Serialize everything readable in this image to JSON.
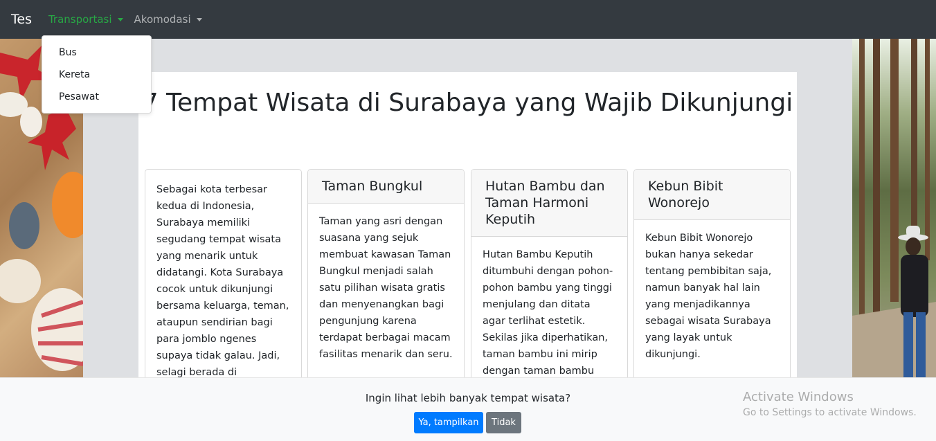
{
  "navbar": {
    "brand": "Tes",
    "items": [
      {
        "label": "Transportasi"
      },
      {
        "label": "Akomodasi"
      }
    ],
    "dropdown": [
      "Bus",
      "Kereta",
      "Pesawat"
    ]
  },
  "main": {
    "title": "7 Tempat Wisata di Surabaya yang Wajib Dikunjungi",
    "cards": [
      {
        "header": "",
        "body": "Sebagai kota terbesar kedua di Indonesia, Surabaya memiliki segudang tempat wisata yang menarik untuk didatangi. Kota Surabaya cocok untuk dikunjungi bersama keluarga, teman, ataupun sendirian bagi para jomblo ngenes supaya tidak galau. Jadi, selagi berada di Surabaya,"
      },
      {
        "header": "Taman Bungkul",
        "body": "Taman yang asri dengan suasana yang sejuk membuat kawasan Taman Bungkul menjadi salah satu pilihan wisata gratis dan menyenangkan bagi pengunjung karena terdapat berbagai macam fasilitas menarik dan seru."
      },
      {
        "header": "Hutan Bambu dan Taman Harmoni Keputih",
        "body": "Hutan Bambu Keputih ditumbuhi dengan pohon-pohon bambu yang tinggi menjulang dan ditata agar terlihat estetik. Sekilas jika diperhatikan, taman bambu ini mirip dengan taman bambu yang ada di"
      },
      {
        "header": "Kebun Bibit Wonorejo",
        "body": "Kebun Bibit Wonorejo bukan hanya sekedar tentang pembibitan saja, namun banyak hal lain yang menjadikannya sebagai wisata Surabaya yang layak untuk dikunjungi."
      }
    ]
  },
  "footer": {
    "prompt": "Ingin lihat lebih banyak tempat wisata?",
    "yes_label": "Ya, tampilkan",
    "no_label": "Tidak"
  },
  "watermark": {
    "line1": "Activate Windows",
    "line2": "Go to Settings to activate Windows."
  },
  "colors": {
    "navbar_bg": "#343a40",
    "active_nav": "#28a745",
    "primary": "#007bff",
    "secondary": "#6c757d"
  }
}
